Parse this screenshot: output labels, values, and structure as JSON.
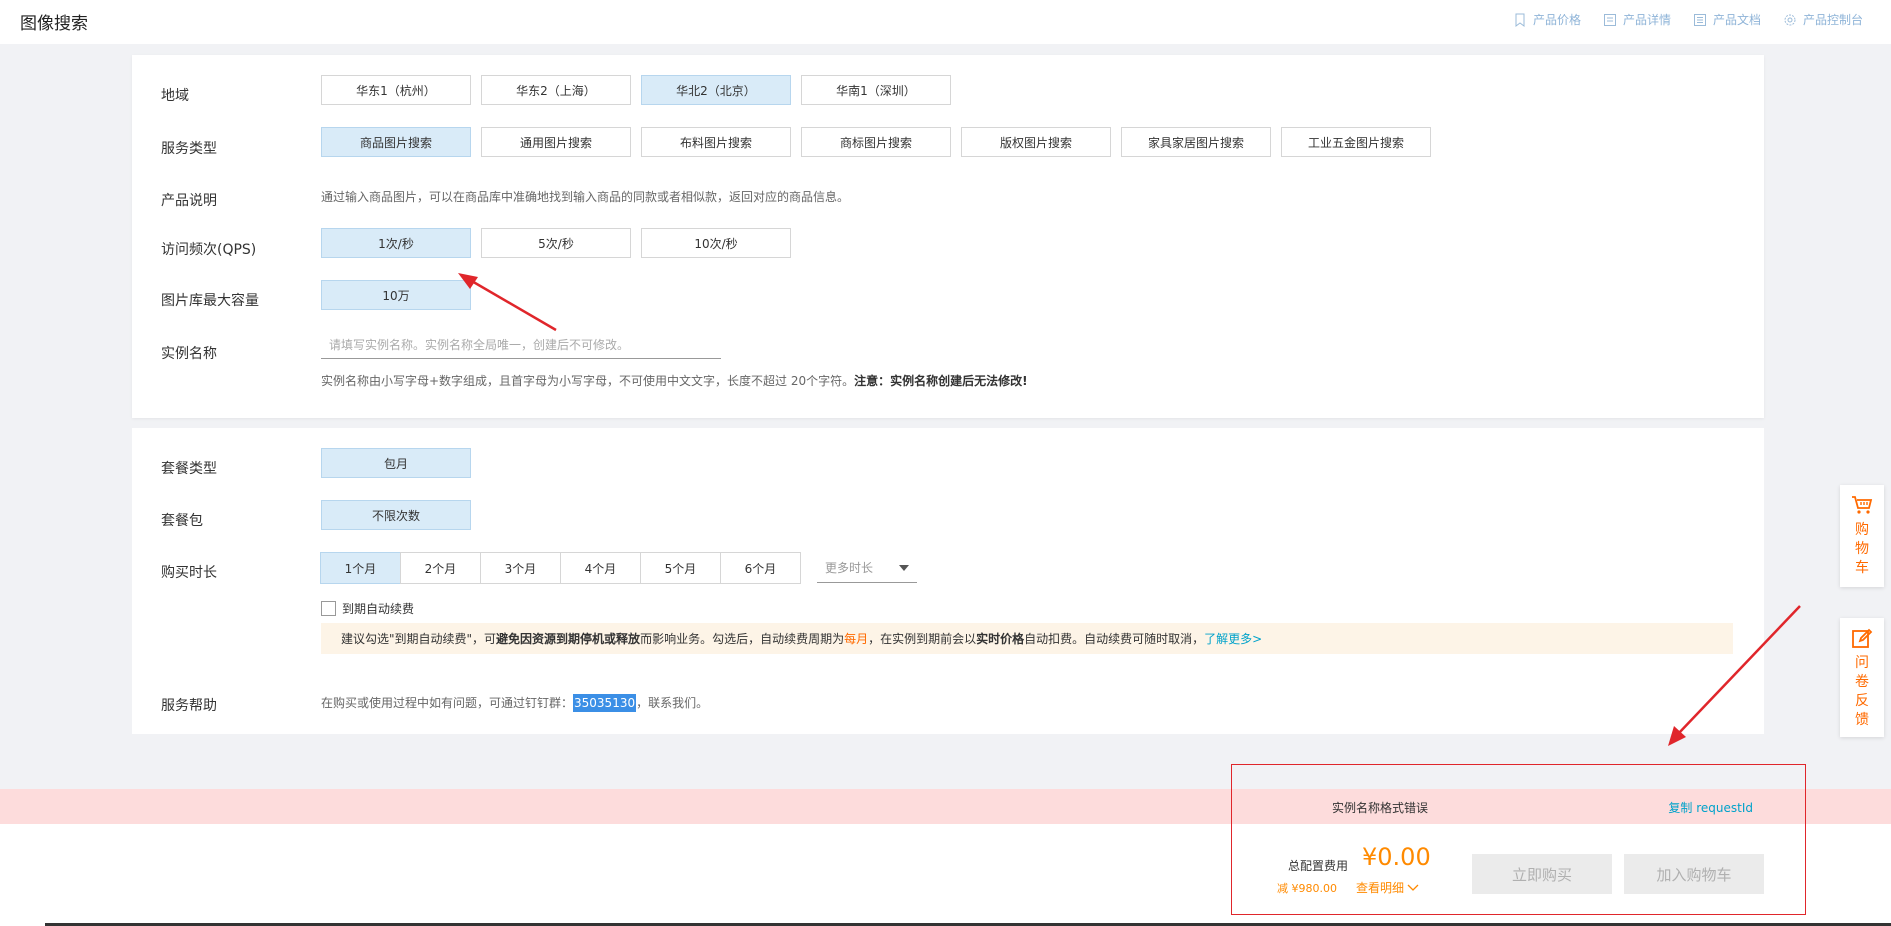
{
  "header": {
    "title": "图像搜索",
    "nav": [
      {
        "label": "产品价格",
        "icon": "bookmark-icon"
      },
      {
        "label": "产品详情",
        "icon": "document-icon"
      },
      {
        "label": "产品文档",
        "icon": "list-document-icon"
      },
      {
        "label": "产品控制台",
        "icon": "gear-icon"
      }
    ]
  },
  "config": {
    "region": {
      "label": "地域",
      "options": [
        "华东1（杭州）",
        "华东2（上海）",
        "华北2（北京）",
        "华南1（深圳）"
      ],
      "selected": "华北2（北京）"
    },
    "service_type": {
      "label": "服务类型",
      "options": [
        "商品图片搜索",
        "通用图片搜索",
        "布料图片搜索",
        "商标图片搜索",
        "版权图片搜索",
        "家具家居图片搜索",
        "工业五金图片搜索"
      ],
      "selected": "商品图片搜索"
    },
    "product_desc": {
      "label": "产品说明",
      "text": "通过输入商品图片，可以在商品库中准确地找到输入商品的同款或者相似款，返回对应的商品信息。"
    },
    "qps": {
      "label": "访问频次(QPS)",
      "options": [
        "1次/秒",
        "5次/秒",
        "10次/秒"
      ],
      "selected": "1次/秒"
    },
    "capacity": {
      "label": "图片库最大容量",
      "options": [
        "10万"
      ],
      "selected": "10万"
    },
    "instance_name": {
      "label": "实例名称",
      "placeholder": "请填写实例名称。实例名称全局唯一，创建后不可修改。",
      "value": "",
      "hint": "实例名称由小写字母+数字组成，且首字母为小写字母，不可使用中文文字，长度不超过 20个字符。",
      "hint_bold": "注意：实例名称创建后无法修改!"
    }
  },
  "package": {
    "plan_type": {
      "label": "套餐类型",
      "options": [
        "包月"
      ],
      "selected": "包月"
    },
    "plan_pack": {
      "label": "套餐包",
      "options": [
        "不限次数"
      ],
      "selected": "不限次数"
    },
    "duration": {
      "label": "购买时长",
      "options": [
        "1个月",
        "2个月",
        "3个月",
        "4个月",
        "5个月",
        "6个月"
      ],
      "selected": "1个月",
      "more_label": "更多时长"
    },
    "auto_renew": {
      "label": "到期自动续费",
      "checked": false
    },
    "tip": {
      "t1": "建议勾选\"到期自动续费\"，可",
      "b1": "避免因资源到期停机或释放",
      "t2": "而影响业务。勾选后，自动续费周期为 ",
      "o1": "每月",
      "t3": "，在实例到期前会以",
      "b2": "实时价格",
      "t4": "自动扣费。自动续费可随时取消，",
      "link": "了解更多>"
    },
    "help": {
      "label": "服务帮助",
      "text1": "在购买或使用过程中如有问题，可通过钉钉群：",
      "group_id": "35035130",
      "text2": "，联系我们。"
    }
  },
  "error_bar": {
    "text": "实例名称格式错误",
    "link": "复制 requestId"
  },
  "footer": {
    "fee_label": "总配置费用",
    "price": "¥0.00",
    "discount": "减 ¥980.00",
    "detail_link": "查看明细",
    "buy_now": "立即购买",
    "add_to_cart": "加入购物车"
  },
  "side": {
    "cart": "购物车",
    "feedback": "问卷反馈"
  },
  "colors": {
    "accent": "#ff6a00",
    "selected_bg": "#d9ebf8",
    "link": "#00a2ca",
    "error_bg": "#fddcdc",
    "annotation_red": "#e0262b"
  }
}
